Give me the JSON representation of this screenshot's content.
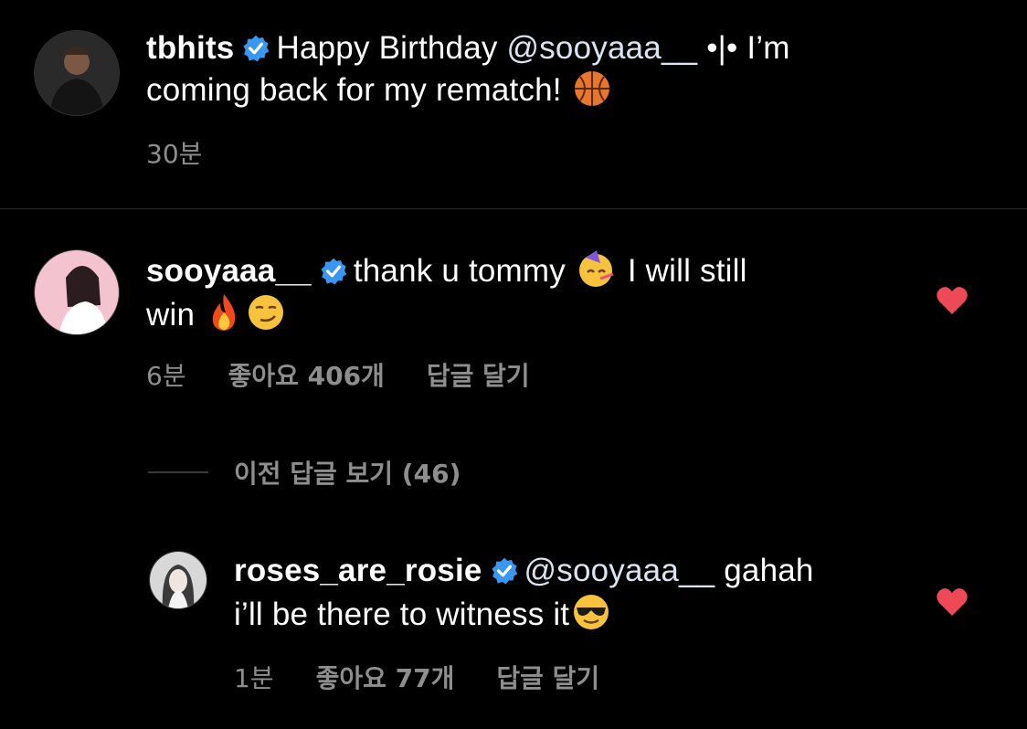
{
  "comments": [
    {
      "username": "tbhits",
      "text_line1": "Happy Birthday ",
      "mention": "@sooyaaa__",
      "text_line1b": " •|• I’m",
      "text_line2": "coming back for my rematch! ",
      "time": "30분"
    },
    {
      "username": "sooyaaa__",
      "text_line1": "thank u tommy ",
      "text_line1b": " I will still",
      "text_line2": "win ",
      "time": "6분",
      "likes": "좋아요 406개",
      "reply": "답글 달기"
    },
    {
      "username": "roses_are_rosie",
      "mention": "@sooyaaa__",
      "text_line1b": " gahah",
      "text_line2": "i’ll be there to witness it",
      "time": "1분",
      "likes": "좋아요 77개",
      "reply": "답글 달기"
    }
  ],
  "view_replies": "이전 답글 보기 (46)",
  "icons": {
    "verified": "verified-badge-icon",
    "heart": "heart-icon",
    "heart_color": "#ed4956",
    "badge_color": "#3897f0"
  }
}
